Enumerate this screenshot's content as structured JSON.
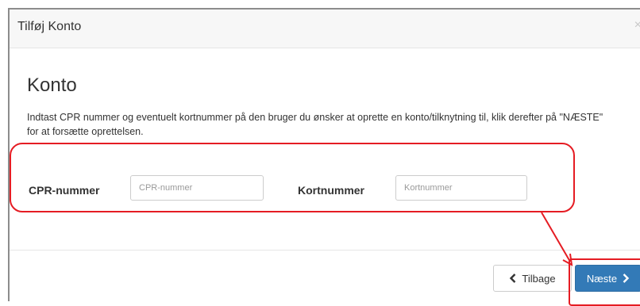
{
  "dialog": {
    "title": "Tilføj Konto",
    "close_symbol": "×"
  },
  "section": {
    "title": "Konto",
    "description": "Indtast CPR nummer og eventuelt kortnummer på den bruger du ønsker at oprette en konto/tilknytning til, klik derefter på \"NÆSTE\" for at forsætte oprettelsen."
  },
  "form": {
    "cpr": {
      "label": "CPR-nummer",
      "placeholder": "CPR-nummer",
      "value": ""
    },
    "card": {
      "label": "Kortnummer",
      "placeholder": "Kortnummer",
      "value": ""
    }
  },
  "buttons": {
    "back": {
      "label": "Tilbage",
      "icon": "chevron-left-icon"
    },
    "next": {
      "label": "Næste",
      "icon": "chevron-right-icon"
    }
  },
  "annotation": {
    "color": "#e51c23"
  },
  "colors": {
    "primary": "#337ab7",
    "header_bg": "#f7f7f7"
  }
}
